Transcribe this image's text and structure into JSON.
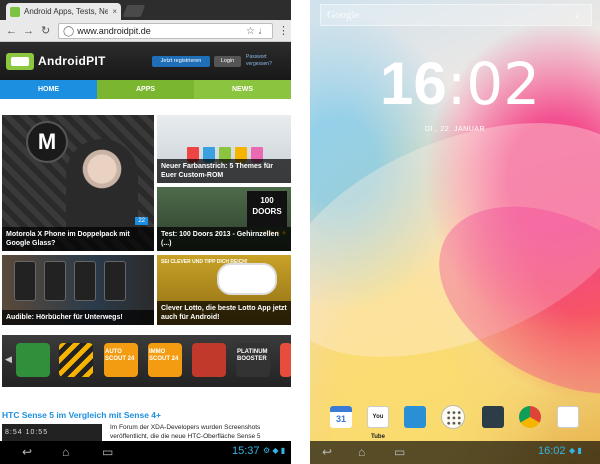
{
  "browser": {
    "tab_title": "Android Apps, Tests, News",
    "tab_close": "×",
    "url": "www.androidpit.de",
    "icons": {
      "back": "back-arrow-icon",
      "forward": "forward-arrow-icon",
      "reload": "reload-icon",
      "star": "star-icon",
      "mic": "mic-icon",
      "menu": "overflow-menu-icon"
    }
  },
  "site": {
    "logo_text": "AndroidPIT",
    "register_label": "Jetzt registrieren",
    "login_label": "Login",
    "password_link": "Passwort vergessen?",
    "nav": [
      "HOME",
      "APPS",
      "NEWS"
    ]
  },
  "tiles": [
    {
      "caption": "Motorola X Phone im Doppelpack mit Google Glass?",
      "logo": "M",
      "badge": "22"
    },
    {
      "caption": "Neuer Farbanstrich: 5 Themes für Euer Custom-ROM"
    },
    {
      "caption": "Test: 100 Doors 2013 - Gehirnzellen (...)",
      "badge_text": "100 DOORS",
      "stars": "★★★★"
    },
    {
      "caption": "Audible: Hörbücher für Unterwegs!"
    },
    {
      "caption": "Clever Lotto, die beste Lotto App jetzt auch für Android!",
      "tag": "SEI CLEVER UND TIPP DICH REICH!"
    }
  ],
  "app_strip": {
    "arrow": "◀",
    "labels": [
      "AUTO SCOUT 24",
      "IMMO SCOUT 24",
      "PLATINUM BOOSTER"
    ]
  },
  "article": {
    "title": "HTC Sense 5 im Vergleich mit Sense 4+",
    "thumb_text": "8:54   10:55",
    "text": "Im Forum der XDA-Developers wurden Screenshots veröffentlicht, die die neue HTC-Oberfläche Sense 5"
  },
  "left_status": {
    "time": "15:37",
    "icons": "⚙ ◆ ▮"
  },
  "home": {
    "search_label": "Google",
    "clock_hours": "16",
    "clock_sep": ":",
    "clock_minutes": "02",
    "date": "DI., 22. JANUAR",
    "calendar_day": "31",
    "youtube_label": "You Tube",
    "dock_icons": [
      "calendar-icon",
      "youtube-icon",
      "contacts-icon",
      "all-apps-icon",
      "settings-icon",
      "chrome-icon",
      "play-store-icon"
    ]
  },
  "right_status": {
    "time": "16:02",
    "icons": "◆ ▮"
  },
  "sys_buttons": {
    "back": "↩",
    "home": "⌂",
    "recents": "▭"
  }
}
